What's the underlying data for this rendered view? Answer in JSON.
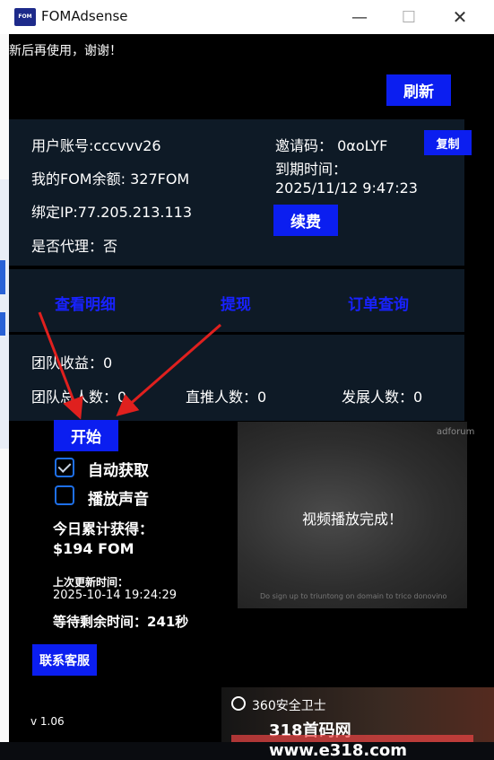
{
  "window": {
    "app_icon_text": "FOM",
    "title": "FOMAdsense",
    "minimize_glyph": "—",
    "maximize_glyph": "☐",
    "close_glyph": "✕"
  },
  "marquee": "新后再使用，谢谢！",
  "buttons": {
    "refresh": "刷新",
    "copy": "复制",
    "renew": "续费",
    "start": "开始",
    "service": "联系客服"
  },
  "account": {
    "username": "用户账号:cccvvv26",
    "balance": "我的FOM余额:  327FOM",
    "bound_ip": "绑定IP:77.205.213.113",
    "agent": "是否代理：否",
    "invite_code": "邀请码：  0αoLYF",
    "expire_label": "到期时间：",
    "expire_value": "2025/11/12 9:47:23"
  },
  "links": {
    "details": "查看明细",
    "withdraw": "提现",
    "orders": "订单查询"
  },
  "team": {
    "income": "团队收益：0",
    "total_members": "团队总人数：0",
    "direct_members": "直推人数：0",
    "growth_members": "发展人数：0"
  },
  "options": {
    "auto_fetch": "自动获取",
    "auto_fetch_checked": true,
    "play_sound": "播放声音",
    "play_sound_checked": false
  },
  "stats": {
    "today_label": "今日累计获得：",
    "today_value": "$194 FOM",
    "last_update_label": "上次更新时间：",
    "last_update_value": "2025-10-14 19:24:29",
    "wait_remaining": "等待剩余时间：241秒"
  },
  "video": {
    "status": "视频播放完成！",
    "logo": "adforum",
    "caption": "Do sign up to triuntong on domain to trico donovino"
  },
  "version": "v 1.06",
  "overlay": {
    "title": "360安全卫士",
    "watermark": "318首码网 www.e318.com"
  },
  "colors": {
    "accent_blue": "#0b1ef0",
    "link_blue": "#1822ff",
    "card_bg": "#0e1a26",
    "arrow_red": "#e0201e"
  },
  "icons": [
    "app-logo-icon",
    "checkmark-icon",
    "shield-icon",
    "arrow-icon"
  ]
}
